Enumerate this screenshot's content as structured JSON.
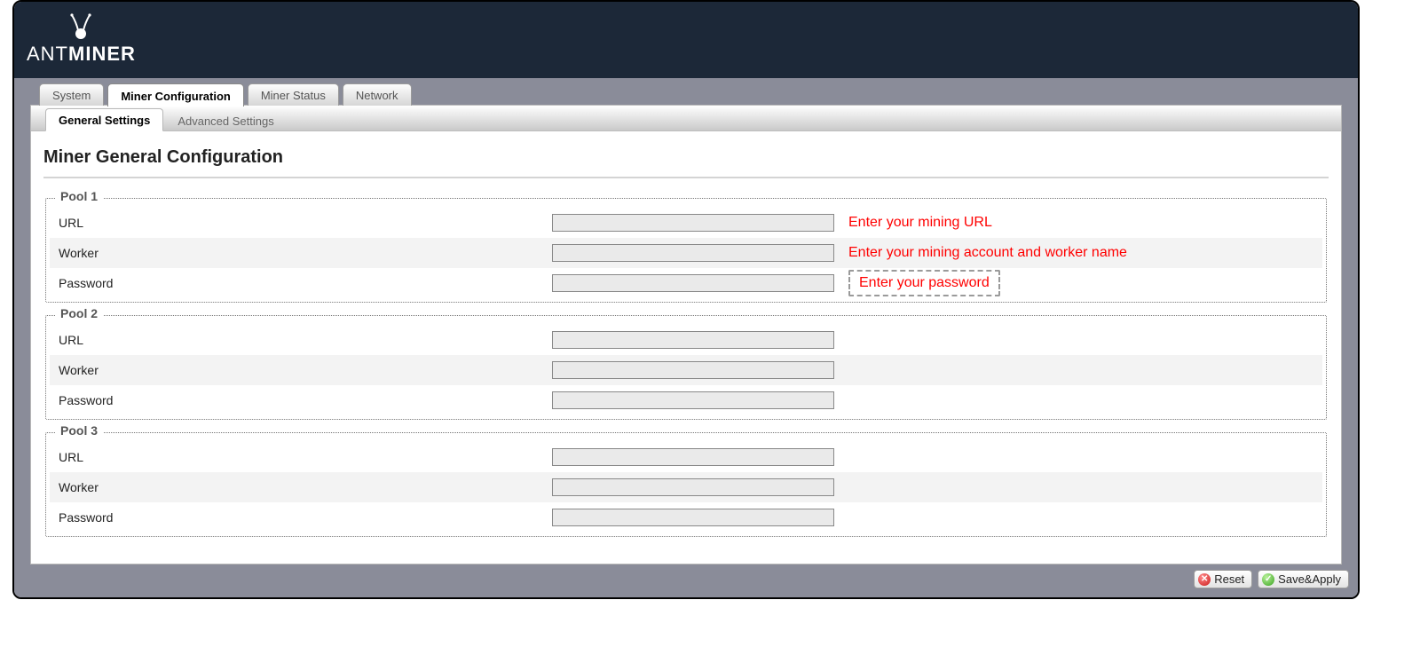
{
  "brand": {
    "prefix": "ANT",
    "suffix": "MINER"
  },
  "tabs": {
    "system": "System",
    "miner_config": "Miner Configuration",
    "miner_status": "Miner Status",
    "network": "Network"
  },
  "subtabs": {
    "general": "General Settings",
    "advanced": "Advanced Settings"
  },
  "page_title": "Miner General Configuration",
  "field_labels": {
    "url": "URL",
    "worker": "Worker",
    "password": "Password"
  },
  "pools": [
    {
      "legend": "Pool 1",
      "url": "",
      "worker": "",
      "password": "",
      "hints": {
        "url": "Enter your mining URL",
        "worker": "Enter your mining account and worker name",
        "password": "Enter your password"
      }
    },
    {
      "legend": "Pool 2",
      "url": "",
      "worker": "",
      "password": ""
    },
    {
      "legend": "Pool 3",
      "url": "",
      "worker": "",
      "password": ""
    }
  ],
  "buttons": {
    "reset": "Reset",
    "save": "Save&Apply"
  },
  "colors": {
    "banner": "#1c2838",
    "workspace": "#8a8c99",
    "hint": "#ff0000"
  }
}
